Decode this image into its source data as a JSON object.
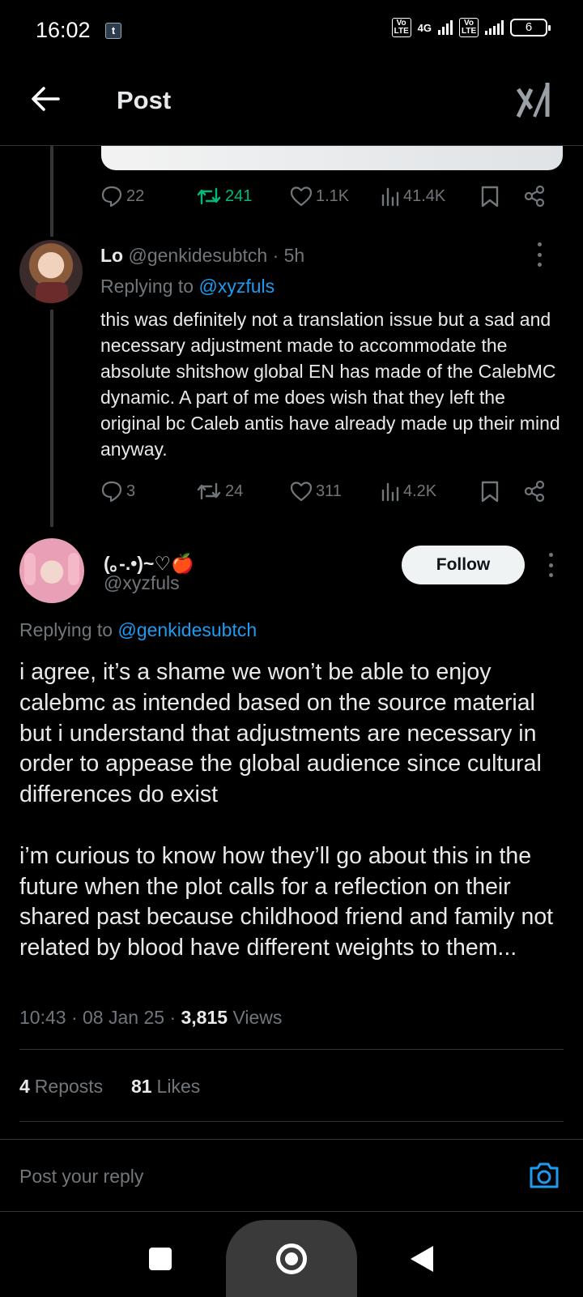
{
  "status_bar": {
    "time": "16:02",
    "notification_icon": "tumblr-icon",
    "network_label": "4G",
    "volte_1": "Vo LTE",
    "volte_2": "Vo LTE",
    "battery": "6"
  },
  "header": {
    "title": "Post",
    "back_icon": "arrow-left-icon",
    "grok_icon": "grok-icon"
  },
  "parent_tweet_actions": {
    "replies": "22",
    "reposts": "241",
    "likes": "1.1K",
    "views": "41.4K"
  },
  "reply_tweet": {
    "name": "Lo",
    "handle": "@genkidesubtch",
    "time": "· 5h",
    "replying_prefix": "Replying to",
    "replying_to": "@xyzfuls",
    "text": "this was definitely not a translation issue but a sad and necessary adjustment made to accommodate the absolute shitshow global EN has made of the CalebMC dynamic. A part of me does wish that they left the original bc Caleb antis have already made up their mind anyway.",
    "actions": {
      "replies": "3",
      "reposts": "24",
      "likes": "311",
      "views": "4.2K"
    }
  },
  "main_tweet": {
    "name": "(｡-.•)~♡🍎",
    "handle": "@xyzfuls",
    "follow_label": "Follow",
    "replying_prefix": "Replying to",
    "replying_to": "@genkidesubtch",
    "text": "i agree, it’s a shame we won’t be able to enjoy calebmc as intended based on the source material but i understand that adjustments are necessary in order to appease the global audience since cultural differences do exist\n\ni’m curious to know how they’ll go about this in the future when the plot calls for a reflection on their shared past because childhood friend and family not related by blood have different weights to them...",
    "time": "10:43",
    "date": "08 Jan 25",
    "views_count": "3,815",
    "views_label": "Views",
    "reposts_count": "4",
    "reposts_label": "Reposts",
    "likes_count": "81",
    "likes_label": "Likes"
  },
  "reply_composer": {
    "placeholder": "Post your reply",
    "camera_icon": "camera-icon"
  },
  "colors": {
    "background": "#000000",
    "text": "#e7e9ea",
    "muted": "#71767b",
    "accent": "#1d9bf0",
    "repost_green": "#00ba7c"
  }
}
